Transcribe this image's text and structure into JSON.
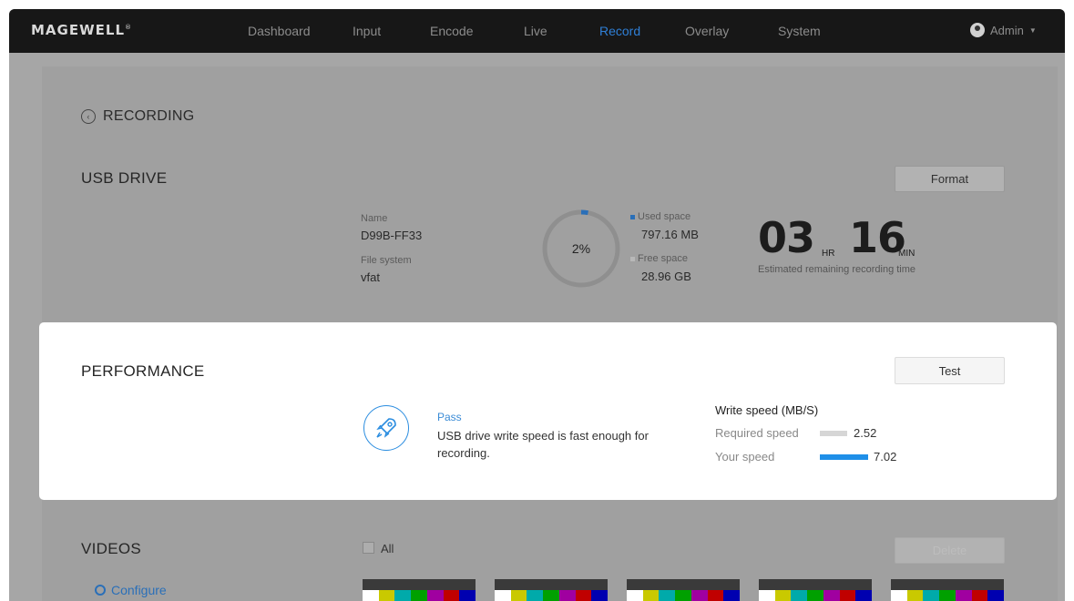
{
  "brand": {
    "logo": "MAGEWELL",
    "registered": "®"
  },
  "nav": {
    "items": [
      "Dashboard",
      "Input",
      "Encode",
      "Live",
      "Record",
      "Overlay",
      "System"
    ],
    "active": "Record",
    "user": "Admin"
  },
  "recording": {
    "title": "RECORDING"
  },
  "usb_drive": {
    "title": "USB DRIVE",
    "format_button": "Format",
    "name_label": "Name",
    "name": "D99B-FF33",
    "fs_label": "File system",
    "fs": "vfat",
    "usage_percent_label": "2%",
    "usage_fraction": 0.02,
    "used_label": "Used space",
    "used_value": "797.16 MB",
    "free_label": "Free space",
    "free_value": "28.96 GB",
    "remaining_hours": "03",
    "hours_unit": "HR",
    "remaining_minutes": "16",
    "minutes_unit": "MIN",
    "remaining_caption": "Estimated remaining recording time"
  },
  "performance": {
    "title": "PERFORMANCE",
    "test_button": "Test",
    "status": "Pass",
    "message": "USB drive write speed is fast enough for recording.",
    "write_speed_title": "Write speed (MB/S)",
    "required_label": "Required speed",
    "required_value": "2.52",
    "your_label": "Your speed",
    "your_value": "7.02"
  },
  "videos": {
    "title": "VIDEOS",
    "select_all": "All",
    "delete_button": "Delete",
    "configure_link": "Configure"
  },
  "colors": {
    "accent": "#2f7fd6",
    "topbar": "#171717",
    "overlay": "#a0a0a0",
    "your_speed_bar": "#1f8fe8",
    "required_speed_bar": "#d6d6d6"
  }
}
